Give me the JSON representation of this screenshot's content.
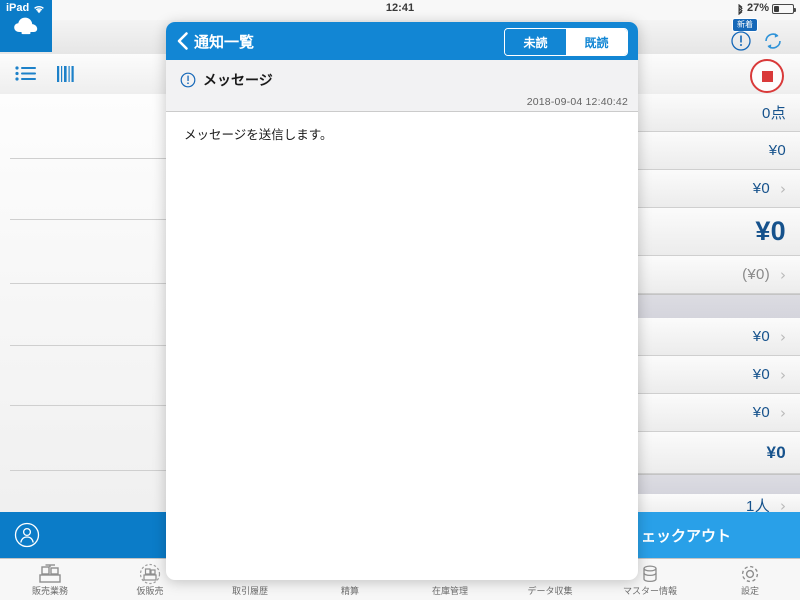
{
  "status_bar": {
    "device": "iPad",
    "wifi_icon": "wifi-icon",
    "time": "12:41",
    "bluetooth_icon": "bluetooth-icon",
    "battery_percent": "27%",
    "battery_level": 27
  },
  "app": {
    "cloud_icon": "cloud-upload-icon",
    "toolbar": {
      "list_icon": "list-icon",
      "barcode_icon": "barcode-icon",
      "stop_icon": "stop-record-icon"
    },
    "notification_cluster": {
      "badge_label": "新着",
      "info_icon": "info-circle-icon",
      "refresh_icon": "refresh-icon"
    },
    "summary_rows": [
      {
        "value": "0点",
        "style": "normal",
        "chevron": false
      },
      {
        "value": "¥0",
        "style": "normal",
        "chevron": false
      },
      {
        "value": "¥0",
        "style": "normal",
        "chevron": true
      },
      {
        "value": "¥0",
        "style": "big",
        "chevron": false
      },
      {
        "value": "(¥0)",
        "style": "muted",
        "chevron": true
      },
      {
        "value": "¥0",
        "style": "normal",
        "chevron": true
      },
      {
        "value": "¥0",
        "style": "normal",
        "chevron": true
      },
      {
        "value": "¥0",
        "style": "normal",
        "chevron": true
      },
      {
        "value": "¥0",
        "style": "bold",
        "chevron": false
      },
      {
        "value": "1人",
        "style": "normal",
        "chevron": true
      }
    ],
    "action_bar": {
      "user_icon": "user-avatar-icon",
      "checkout_label": "ェックアウト"
    },
    "tabs": [
      {
        "label": "販売業務",
        "icon": "cash-register-icon"
      },
      {
        "label": "仮販売",
        "icon": "provisional-sale-icon"
      },
      {
        "label": "取引履歴",
        "icon": "transaction-history-icon"
      },
      {
        "label": "精算",
        "icon": "settlement-icon"
      },
      {
        "label": "在庫管理",
        "icon": "inventory-icon"
      },
      {
        "label": "データ収集",
        "icon": "data-collection-icon"
      },
      {
        "label": "マスター情報",
        "icon": "database-icon"
      },
      {
        "label": "設定",
        "icon": "gear-icon"
      }
    ]
  },
  "modal": {
    "back_icon": "back-chevron-icon",
    "title": "通知一覧",
    "segment_unread": "未読",
    "segment_read": "既読",
    "selected_segment": "既読",
    "message_icon": "info-circle-icon",
    "message_title": "メッセージ",
    "timestamp": "2018-09-04 12:40:42",
    "body": "メッセージを送信します。"
  },
  "colors": {
    "brand_blue": "#0b7cc8",
    "nav_blue": "#1286d4",
    "checkout_blue": "#29a0e8",
    "value_blue": "#16528c",
    "stop_red": "#d93a3a"
  }
}
